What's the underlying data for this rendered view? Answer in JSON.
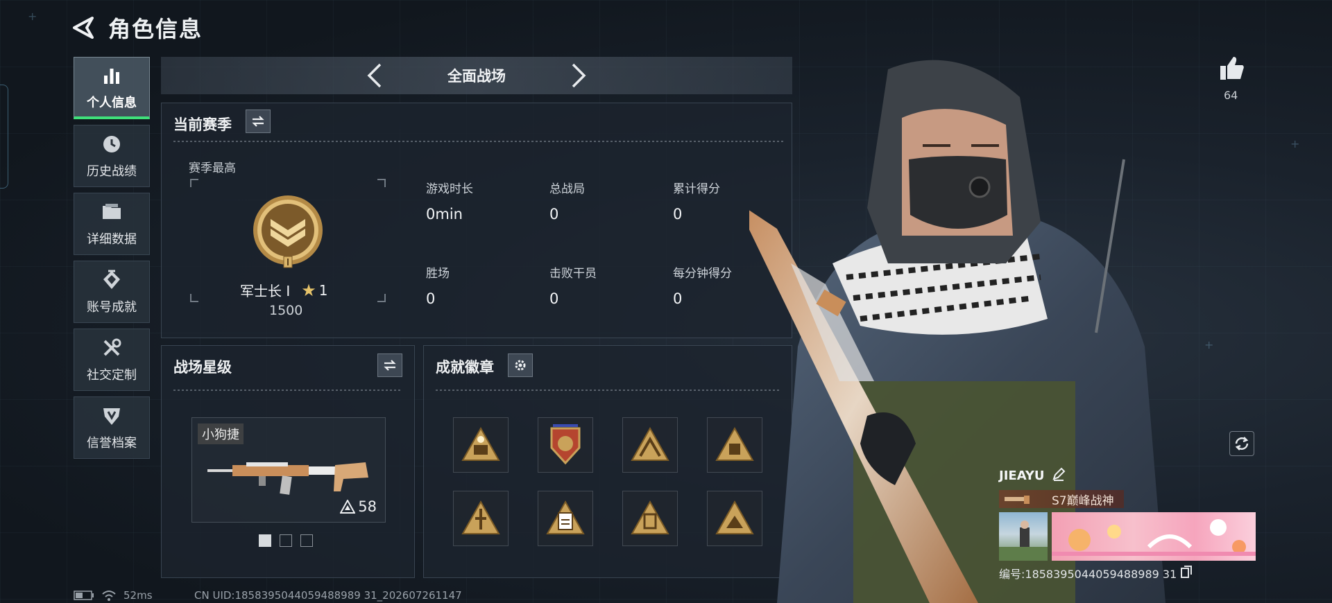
{
  "header": {
    "title": "角色信息"
  },
  "nav": {
    "items": [
      {
        "label": "个人信息",
        "icon": "bar-chart-icon",
        "active": true
      },
      {
        "label": "历史战绩",
        "icon": "history-clock-icon",
        "active": false
      },
      {
        "label": "详细数据",
        "icon": "folder-icon",
        "active": false
      },
      {
        "label": "账号成就",
        "icon": "medal-icon",
        "active": false
      },
      {
        "label": "社交定制",
        "icon": "tools-icon",
        "active": false
      },
      {
        "label": "信誉档案",
        "icon": "shield-icon",
        "active": false
      }
    ]
  },
  "mode": {
    "title": "全面战场"
  },
  "season": {
    "title": "当前赛季",
    "best_label": "赛季最高",
    "rank_name": "军士长 I",
    "rank_stars": "1",
    "rank_score": "1500",
    "stats": [
      {
        "label": "游戏时长",
        "value": "0min"
      },
      {
        "label": "总战局",
        "value": "0"
      },
      {
        "label": "累计得分",
        "value": "0"
      },
      {
        "label": "胜场",
        "value": "0"
      },
      {
        "label": "击败干员",
        "value": "0"
      },
      {
        "label": "每分钟得分",
        "value": "0"
      }
    ]
  },
  "battle_star": {
    "title": "战场星级",
    "weapon_name": "小狗捷",
    "weapon_level": "58",
    "pages": 3,
    "active_page": 0
  },
  "badges": {
    "title": "成就徽章",
    "items": [
      "badge-1",
      "badge-2",
      "badge-3",
      "badge-4",
      "badge-5",
      "badge-6",
      "badge-7",
      "badge-8"
    ]
  },
  "likes": {
    "count": "64"
  },
  "player": {
    "name": "JIEAYU",
    "title": "S7巅峰战神",
    "id_text": "编号:1858395044059488989 31"
  },
  "statusbar": {
    "ping": "52ms",
    "uid": "CN UID:1858395044059488989 31_202607261147"
  },
  "colors": {
    "accent_green": "#3fe07a",
    "gold": "#c9a25a"
  }
}
